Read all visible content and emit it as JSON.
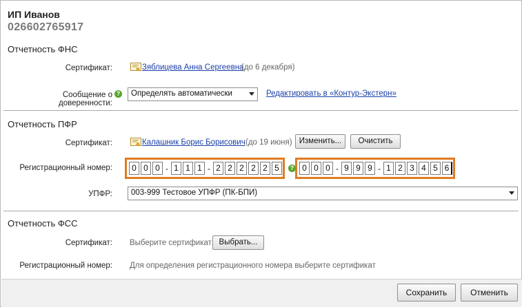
{
  "org": {
    "name": "ИП Иванов",
    "inn": "026602765917"
  },
  "fns": {
    "title": "Отчетность ФНС",
    "cert_label": "Сертификат:",
    "cert_name": "Зяблицева Анна Сергеевна",
    "cert_valid": "(до 6 декабря)",
    "proxy_label": "Сообщение о доверенности:",
    "proxy_value": "Определять автоматически",
    "edit_link": "Редактировать в «Контур-Экстерн»"
  },
  "pfr": {
    "title": "Отчетность ПФР",
    "cert_label": "Сертификат:",
    "cert_name": "Калашник Борис Борисович",
    "cert_valid": "(до 19 июня)",
    "change_button": "Изменить...",
    "clear_button": "Очистить",
    "reg_label": "Регистрационный номер:",
    "reg_number_1": [
      "0",
      "0",
      "0",
      "-",
      "1",
      "1",
      "1",
      "-",
      "2",
      "2",
      "2",
      "2",
      "2",
      "5"
    ],
    "reg_number_2": [
      "0",
      "0",
      "0",
      "-",
      "9",
      "9",
      "9",
      "-",
      "1",
      "2",
      "3",
      "4",
      "5",
      "6"
    ],
    "upfr_label": "УПФР:",
    "upfr_value": "003-999 Тестовое УПФР (ПК-БПИ)"
  },
  "fss": {
    "title": "Отчетность ФСС",
    "cert_label": "Сертификат:",
    "cert_placeholder": "Выберите сертификат",
    "choose_button": "Выбрать...",
    "reg_label": "Регистрационный номер:",
    "reg_hint": "Для определения регистрационного номера выберите сертификат"
  },
  "footer": {
    "save_button": "Сохранить",
    "cancel_button": "Отменить"
  },
  "help_glyph": "?",
  "colors": {
    "highlight": "#e07b22",
    "link": "#1a3fa8",
    "help": "#56a52a"
  }
}
